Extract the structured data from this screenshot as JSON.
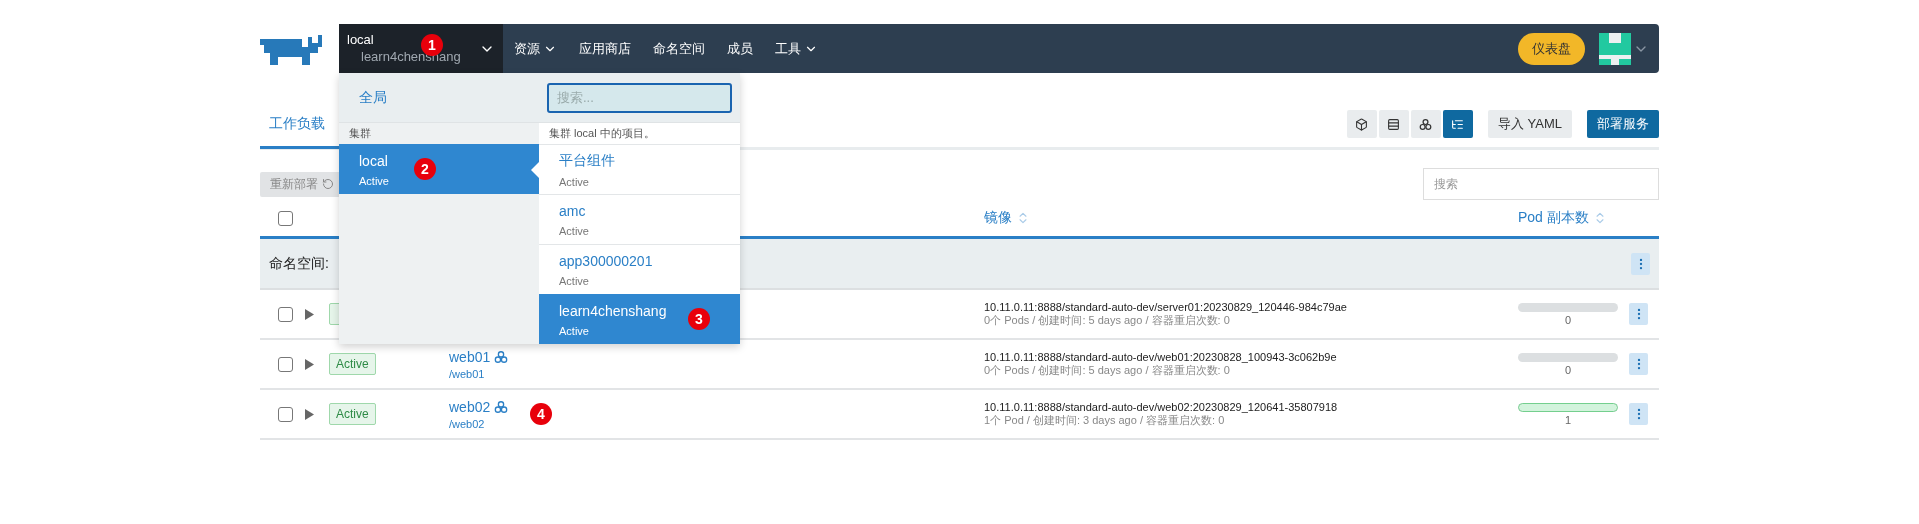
{
  "header": {
    "cluster": {
      "name": "local",
      "project": "learn4chenshang"
    },
    "nav": [
      {
        "label": "资源",
        "has_menu": true
      },
      {
        "label": "应用商店",
        "has_menu": false
      },
      {
        "label": "命名空间",
        "has_menu": false
      },
      {
        "label": "成员",
        "has_menu": false
      },
      {
        "label": "工具",
        "has_menu": true
      }
    ],
    "dashboard_button": "仪表盘"
  },
  "switcher": {
    "global": "全局",
    "search_placeholder": "搜索...",
    "clusters_heading": "集群",
    "projects_heading": "集群 local 中的项目。",
    "clusters": [
      {
        "name": "local",
        "state": "Active",
        "selected": true
      }
    ],
    "projects": [
      {
        "name": "平台组件",
        "state": "Active",
        "selected": false
      },
      {
        "name": "amc",
        "state": "Active",
        "selected": false
      },
      {
        "name": "app300000201",
        "state": "Active",
        "selected": false
      },
      {
        "name": "learn4chenshang",
        "state": "Active",
        "selected": true
      }
    ]
  },
  "page": {
    "tab": {
      "label": "工作负载",
      "selected": true
    },
    "view_buttons": [
      {
        "selected": false
      },
      {
        "selected": false
      },
      {
        "selected": false
      },
      {
        "selected": true
      }
    ],
    "import_button": "导入 YAML",
    "deploy_button": "部署服务",
    "bulk_button": "重新部署",
    "search_placeholder": "搜索"
  },
  "table": {
    "header_checkbox": {
      "checked": false
    },
    "columns": [
      {
        "label": "镜像",
        "sortable": true
      },
      {
        "label": "Pod 副本数",
        "sortable": true
      }
    ],
    "group": {
      "label": "命名空间:"
    },
    "rows": [
      {
        "checked": false,
        "image": "10.11.0.11:8888/standard-auto-dev/server01:20230829_120446-984c79ae",
        "details": "0个 Pods / 创建时间: 5 days ago / 容器重启次数: 0",
        "pods": "0",
        "level": 0
      },
      {
        "checked": false,
        "status": "Active",
        "name": "web01",
        "path": "/web01",
        "image": "10.11.0.11:8888/standard-auto-dev/web01:20230828_100943-3c062b9e",
        "details": "0个 Pods / 创建时间: 5 days ago / 容器重启次数: 0",
        "pods": "0",
        "level": 0
      },
      {
        "checked": false,
        "status": "Active",
        "name": "web02",
        "path": "/web02",
        "image": "10.11.0.11:8888/standard-auto-dev/web02:20230829_120641-35807918",
        "details": "1个 Pod / 创建时间: 3 days ago / 容器重启次数: 0",
        "pods": "1",
        "level": 1
      }
    ]
  },
  "annotations": [
    "1",
    "2",
    "3",
    "4"
  ]
}
